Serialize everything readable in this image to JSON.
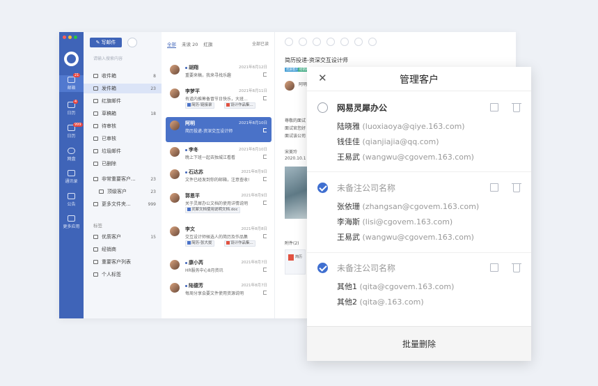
{
  "rail": {
    "items": [
      {
        "label": "邮箱",
        "badge": "21"
      },
      {
        "label": "日历",
        "badge": "4"
      },
      {
        "label": "日历",
        "badge": "999"
      },
      {
        "label": "网盘",
        "badge": ""
      },
      {
        "label": "通讯录",
        "badge": ""
      },
      {
        "label": "公告",
        "badge": ""
      },
      {
        "label": "更多应用",
        "badge": ""
      }
    ]
  },
  "folders": {
    "compose": "写邮件",
    "search_placeholder": "请输入搜索内容",
    "items": [
      {
        "label": "收件箱",
        "count": "8"
      },
      {
        "label": "发件箱",
        "count": "23"
      },
      {
        "label": "红旗邮件",
        "count": ""
      },
      {
        "label": "草稿箱",
        "count": "18"
      },
      {
        "label": "待审核",
        "count": ""
      },
      {
        "label": "已审核",
        "count": ""
      },
      {
        "label": "垃圾邮件",
        "count": ""
      },
      {
        "label": "已删除",
        "count": ""
      },
      {
        "label": "非常重要客户...",
        "count": "23"
      },
      {
        "label": "顶级客户",
        "count": "23"
      },
      {
        "label": "更多文件夹...",
        "count": "999"
      }
    ],
    "tags_header": "标签",
    "tags": [
      {
        "label": "优质客户",
        "count": "15"
      },
      {
        "label": "经销商",
        "count": ""
      },
      {
        "label": "重要客户列表",
        "count": ""
      },
      {
        "label": "个人标签",
        "count": ""
      }
    ]
  },
  "list": {
    "tabs": [
      "全部",
      "未读 20",
      "红旗"
    ],
    "mark_all": "全部已读",
    "rows": [
      {
        "name": "胡翔",
        "date": "2021年8月12日",
        "subject": "重要来稿，我来寻找乐趣",
        "att1": "",
        "att2": ""
      },
      {
        "name": "李梦平",
        "date": "2021年8月11日",
        "subject": "有道内推筹备冒节日快乐，大班...",
        "att1": "简历-链接录",
        "att2": "设计作品集..."
      },
      {
        "name": "阿明",
        "date": "2021年8月10日",
        "subject": "简历投递-资深交互设计师",
        "att1": "",
        "att2": ""
      },
      {
        "name": "李冬",
        "date": "2021年8月10日",
        "subject": "晚上下班一起去独城江看看",
        "att1": "",
        "att2": ""
      },
      {
        "name": "石达苏",
        "date": "2021年8月9日",
        "subject": "文件已经发到你的邮箱，注意查收!",
        "att1": "",
        "att2": ""
      },
      {
        "name": "郭恩平",
        "date": "2021年8月9日",
        "subject": "关于灵犀办公文档的使用详情说明",
        "att1": "灵犀文档使用说明文档.doc",
        "att2": ""
      },
      {
        "name": "李文",
        "date": "2021年8月8日",
        "subject": "交互设计师候选人的简历及作品集",
        "att1": "简历-张大拢",
        "att2": "设计作品集..."
      },
      {
        "name": "康小芮",
        "date": "2021年8月7日",
        "subject": "HR服务中心8月资讯",
        "att1": "",
        "att2": ""
      },
      {
        "name": "陆德芳",
        "date": "2021年8月7日",
        "subject": "每周分享会要文件使用资源说明",
        "att1": "",
        "att2": ""
      }
    ]
  },
  "reader": {
    "subject": "简历投递-资深交互设计师",
    "tag1": "优质客户",
    "tag2": "经销商",
    "sender": "阿明",
    "body1": "尊敬的面试",
    "body2": "面试官您好",
    "body3": "面试该公司",
    "sign1": "宋美玲",
    "sign2": "2020.10.1",
    "attach_label": "附件(2)",
    "attach_name": "简历"
  },
  "modal": {
    "title": "管理客户",
    "groups": [
      {
        "name": "网易灵犀办公",
        "checked": false,
        "contacts": [
          {
            "name": "陆晓雅",
            "email": "(luoxiaoya@qiye.163.com)"
          },
          {
            "name": "钱佳佳",
            "email": "(qianjiajia@qq.com)"
          },
          {
            "name": "王易武",
            "email": "(wangwu@cgovem.163.com)"
          }
        ]
      },
      {
        "name": "未备注公司名称",
        "checked": true,
        "contacts": [
          {
            "name": "张依珊",
            "email": "(zhangsan@cgovem.163.com)"
          },
          {
            "name": "李海斯",
            "email": "(lisi@cgovem.163.com)"
          },
          {
            "name": "王易武",
            "email": "(wangwu@cgovem.163.com)"
          }
        ]
      },
      {
        "name": "未备注公司名称",
        "checked": true,
        "contacts": [
          {
            "name": "其他1",
            "email": "(qita@cgovem.163.com)"
          },
          {
            "name": "其他2",
            "email": "(qita@.163.com)"
          }
        ]
      }
    ],
    "footer": "批量删除"
  }
}
